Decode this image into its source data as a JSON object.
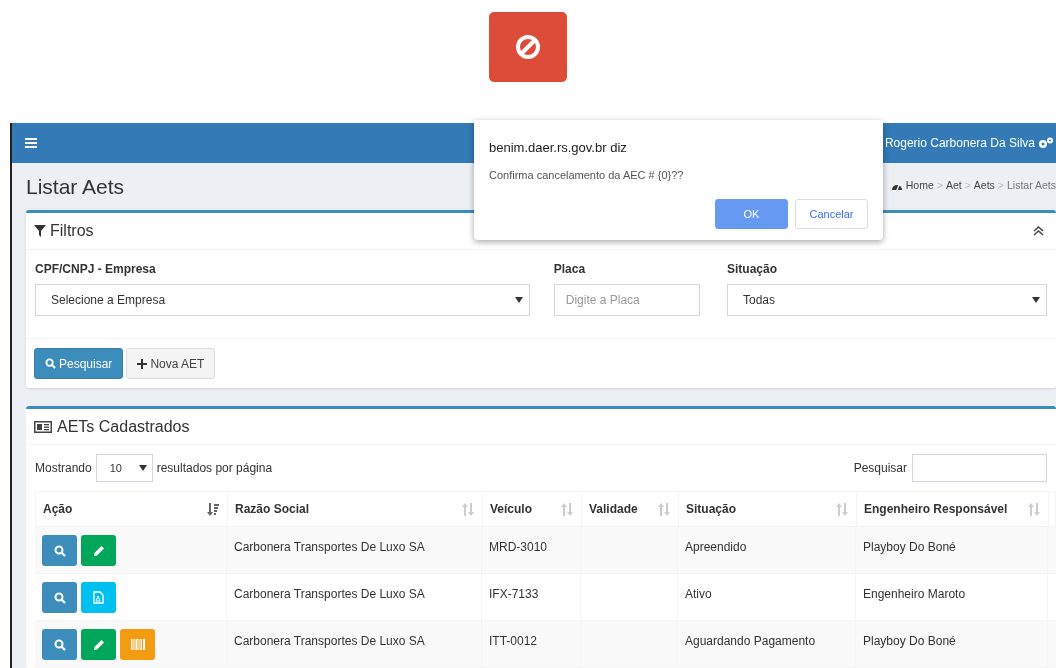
{
  "header": {
    "user_name": "Rogerio Carbonera Da Silva"
  },
  "page_title": "Listar Aets",
  "breadcrumb": [
    "Home",
    "Aet",
    "Aets",
    "Listar Aets"
  ],
  "breadcrumb_separator": ">",
  "filters": {
    "title": "Filtros",
    "fields": [
      {
        "kind": "select",
        "label": "CPF/CNPJ - Empresa",
        "value": "Selecione a Empresa"
      },
      {
        "kind": "input",
        "label": "Placa",
        "placeholder": "Digite a Placa"
      },
      {
        "kind": "select",
        "label": "Situação",
        "value": "Todas"
      }
    ],
    "buttons": [
      {
        "kind": "primary",
        "label": "Pesquisar"
      },
      {
        "kind": "default",
        "label": "Nova AET"
      }
    ]
  },
  "list": {
    "title": "AETs Cadastrados",
    "show_prefix": "Mostrando",
    "page_size": "10",
    "show_suffix": "resultados por página",
    "search_label": "Pesquisar",
    "columns": [
      {
        "label": "Ação",
        "sorted": true
      },
      {
        "label": "Razão Social",
        "sorted": false
      },
      {
        "label": "Veículo",
        "sorted": false
      },
      {
        "label": "Validade",
        "sorted": false
      },
      {
        "label": "Situação",
        "sorted": false
      },
      {
        "label": "Engenheiro Responsável",
        "sorted": false
      }
    ],
    "rows": [
      {
        "actions": [
          {
            "kind": "view"
          },
          {
            "kind": "edit"
          }
        ],
        "company": "Carbonera Transportes De Luxo SA",
        "vehicle": "MRD-3010",
        "status": "Apreendido",
        "engineer": "Playboy Do Boné"
      },
      {
        "actions": [
          {
            "kind": "view"
          },
          {
            "kind": "pdf"
          }
        ],
        "company": "Carbonera Transportes De Luxo SA",
        "vehicle": "IFX-7133",
        "status": "Ativo",
        "engineer": "Engenheiro Maroto"
      },
      {
        "actions": [
          {
            "kind": "view"
          },
          {
            "kind": "edit"
          },
          {
            "kind": "barcode"
          }
        ],
        "company": "Carbonera Transportes De Luxo SA",
        "vehicle": "ITT-0012",
        "status": "Aguardando Pagamento",
        "engineer": "Playboy Do Boné"
      }
    ]
  },
  "dialog": {
    "title": "benim.daer.rs.gov.br diz",
    "message": "Confirma cancelamento da AEC # {0}??",
    "buttons": [
      {
        "kind": "primary",
        "label": "OK"
      },
      {
        "kind": "secondary",
        "label": "Cancelar"
      }
    ]
  }
}
